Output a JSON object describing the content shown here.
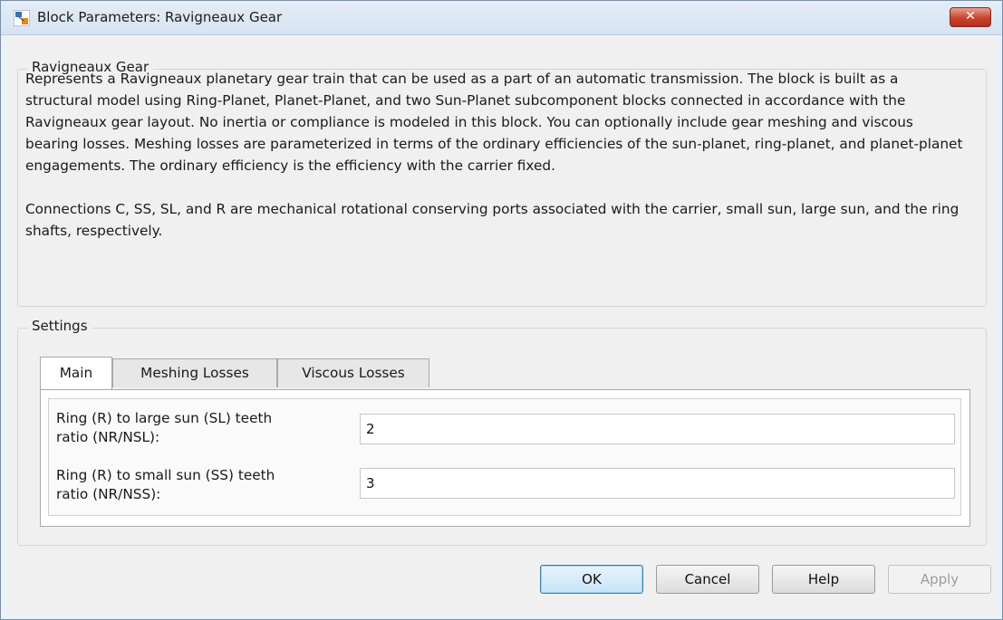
{
  "window": {
    "title": "Block Parameters: Ravigneaux Gear",
    "close_symbol": "✕"
  },
  "description_group": {
    "legend": "Ravigneaux Gear",
    "paragraphs": [
      "Represents a Ravigneaux planetary gear train that can be used as a part of an automatic transmission. The block is built as a structural model using Ring-Planet, Planet-Planet, and two Sun-Planet subcomponent blocks connected in accordance with the Ravigneaux gear layout. No inertia or compliance is modeled in this block. You can optionally include gear meshing and viscous bearing losses. Meshing losses are parameterized in terms of the ordinary efficiencies of the sun-planet, ring-planet, and planet-planet engagements. The ordinary efficiency is the efficiency with the carrier fixed.",
      "Connections C, SS, SL, and R are mechanical rotational conserving ports associated with the carrier, small sun, large sun, and the ring shafts, respectively."
    ]
  },
  "settings_group": {
    "legend": "Settings",
    "tabs": [
      {
        "label": "Main",
        "active": true
      },
      {
        "label": "Meshing Losses",
        "active": false
      },
      {
        "label": "Viscous Losses",
        "active": false
      }
    ],
    "parameters": [
      {
        "label_line1": "Ring (R) to large sun (SL) teeth",
        "label_line2": "ratio (NR/NSL):",
        "value": "2"
      },
      {
        "label_line1": "Ring (R) to small sun (SS) teeth",
        "label_line2": "ratio (NR/NSS):",
        "value": "3"
      }
    ]
  },
  "buttons": {
    "ok": "OK",
    "cancel": "Cancel",
    "help": "Help",
    "apply": "Apply"
  },
  "icons": {
    "app": "simulink-block-icon",
    "close": "close-icon"
  },
  "colors": {
    "close_button": "#c8432d",
    "default_button_border": "#3c7fb1",
    "title_bar": "#d6e3f2"
  }
}
